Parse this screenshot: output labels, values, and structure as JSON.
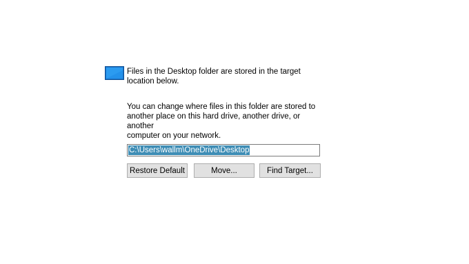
{
  "location_tab": {
    "folder_icon": "desktop-folder-icon",
    "intro_text": "Files in the Desktop folder are stored in the target\nlocation below.",
    "detail_text": "You can change where files in this folder are stored to\nanother place on this hard drive, another drive, or another\ncomputer on your network.",
    "path_value": "C:\\Users\\wallm\\OneDrive\\Desktop",
    "buttons": {
      "restore_default": "Restore Default",
      "move": "Move...",
      "find_target": "Find Target..."
    },
    "colors": {
      "selection": "#3e8db5",
      "button_face": "#e1e1e1",
      "button_border": "#adadad",
      "folder_blue": "#1e90e0"
    }
  }
}
